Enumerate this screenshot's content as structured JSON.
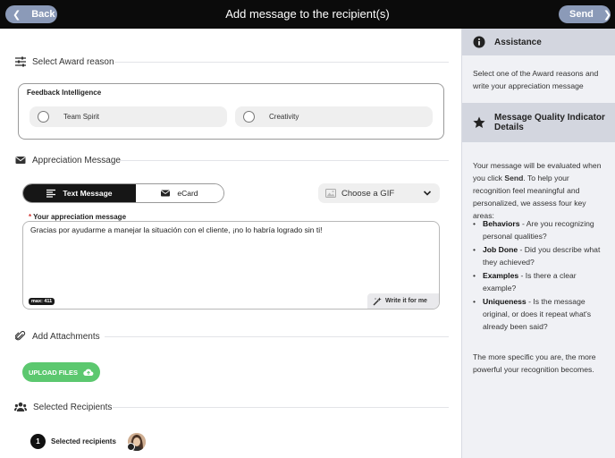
{
  "header": {
    "title": "Add message to the recipient(s)",
    "back_label": "Back",
    "send_label": "Send"
  },
  "award_reason": {
    "section_title": "Select Award reason",
    "group_label": "Feedback Intelligence",
    "options": [
      "Team Spirit",
      "Creativity"
    ]
  },
  "appreciation": {
    "section_title": "Appreciation Message",
    "tabs": [
      "Text Message",
      "eCard"
    ],
    "active_tab": "Text Message",
    "gif_placeholder": "Choose a GIF",
    "required_marker": "*",
    "field_label": "Your appreciation message",
    "message_value": "Gracias por ayudarme a manejar la situación con el cliente, ¡no lo habría logrado sin ti!",
    "max_badge": "max: 411",
    "write_button": "Write it for me"
  },
  "attachments": {
    "section_title": "Add Attachments",
    "upload_label": "UPLOAD FILES"
  },
  "recipients": {
    "section_title": "Selected Recipients",
    "count": "1",
    "label": "Selected recipients"
  },
  "assistance": {
    "title": "Assistance",
    "text": "Select one of the Award reasons and write your appreciation message"
  },
  "quality": {
    "title": "Message Quality Indicator Details",
    "intro_before": "Your message will be evaluated when you click ",
    "intro_bold": "Send",
    "intro_after": ". To help your recognition feel meaningful and personalized, we assess four key areas:",
    "items": [
      {
        "term": "Behaviors",
        "desc": " - Are you recognizing personal qualities?"
      },
      {
        "term": "Job Done",
        "desc": " - Did you describe what they achieved?"
      },
      {
        "term": "Examples",
        "desc": " - Is there a clear example?"
      },
      {
        "term": "Uniqueness",
        "desc": " - Is the message original, or does it repeat what's already been said?"
      }
    ],
    "footer": "The more specific you are, the more powerful your recognition becomes."
  },
  "colors": {
    "header_bg": "#0b0b0b",
    "header_button": "#8b9ab8",
    "upload_green": "#5cc86f",
    "panel_bg": "#f0f1f5",
    "panel_header": "#d3d6df",
    "required_red": "#d0312d"
  }
}
